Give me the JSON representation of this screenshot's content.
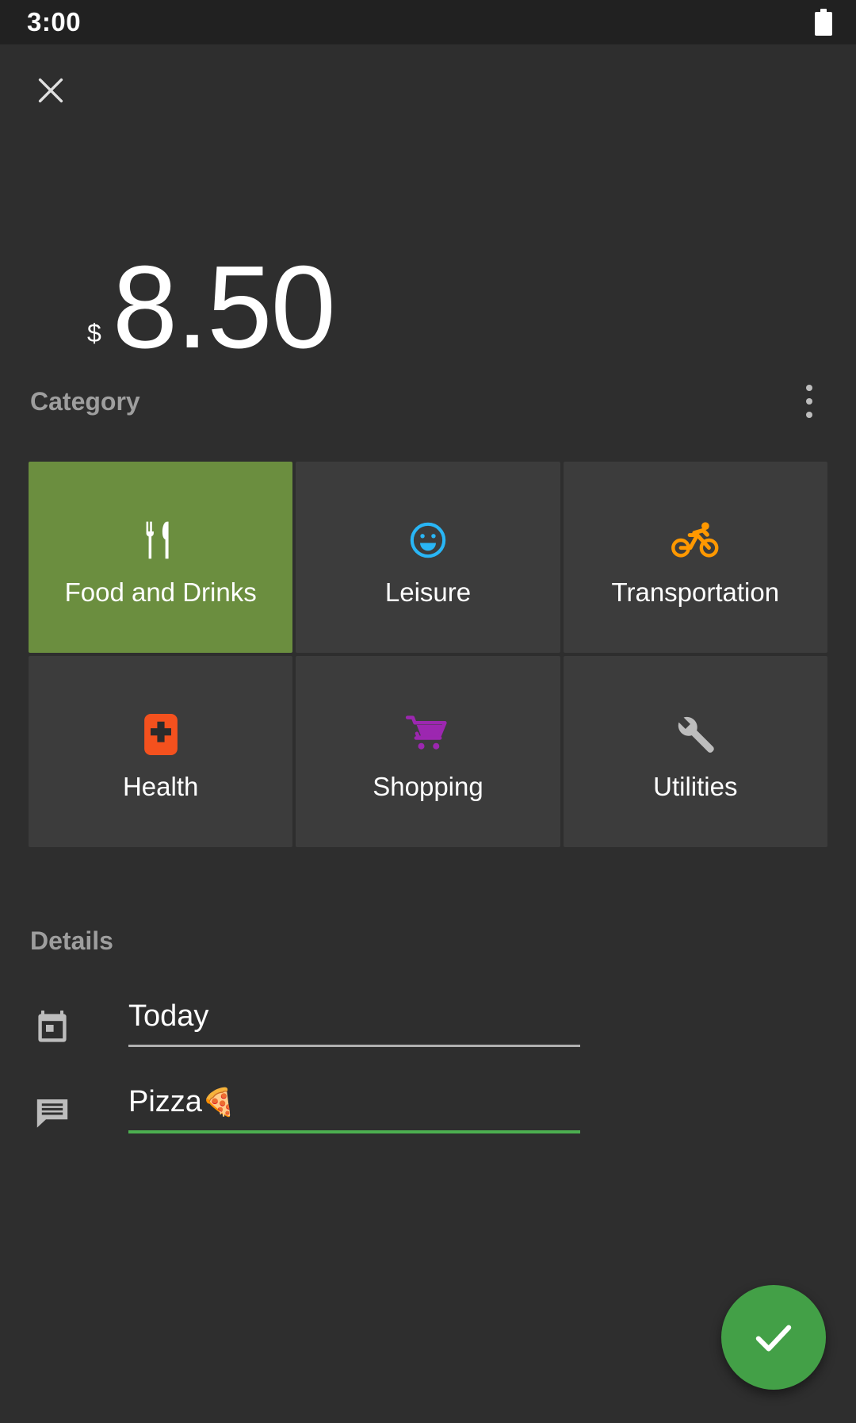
{
  "status_bar": {
    "time": "3:00",
    "battery_icon": "battery-full-icon"
  },
  "header": {
    "close_icon": "close-icon"
  },
  "amount": {
    "currency_symbol": "$",
    "value": "8.50"
  },
  "category_section": {
    "title": "Category",
    "overflow_icon": "more-vertical-icon",
    "selected_color": "#6b8e3f",
    "tiles": [
      {
        "label": "Food and Drinks",
        "icon": "restaurant-icon",
        "color": "#ffffff",
        "selected": true
      },
      {
        "label": "Leisure",
        "icon": "smiley-face-icon",
        "color": "#29b6f6",
        "selected": false
      },
      {
        "label": "Transportation",
        "icon": "bicycle-icon",
        "color": "#ff9800",
        "selected": false
      },
      {
        "label": "Health",
        "icon": "first-aid-icon",
        "color": "#f4511e",
        "selected": false
      },
      {
        "label": "Shopping",
        "icon": "shopping-cart-icon",
        "color": "#9c27b0",
        "selected": false
      },
      {
        "label": "Utilities",
        "icon": "wrench-icon",
        "color": "#bdbdbd",
        "selected": false
      }
    ]
  },
  "details_section": {
    "title": "Details",
    "fields": [
      {
        "icon": "calendar-icon",
        "value": "Today",
        "emoji": "",
        "focused": false
      },
      {
        "icon": "note-icon",
        "value": "Pizza",
        "emoji": "🍕",
        "focused": true
      }
    ]
  },
  "fab": {
    "icon": "check-icon",
    "color": "#43a047"
  }
}
